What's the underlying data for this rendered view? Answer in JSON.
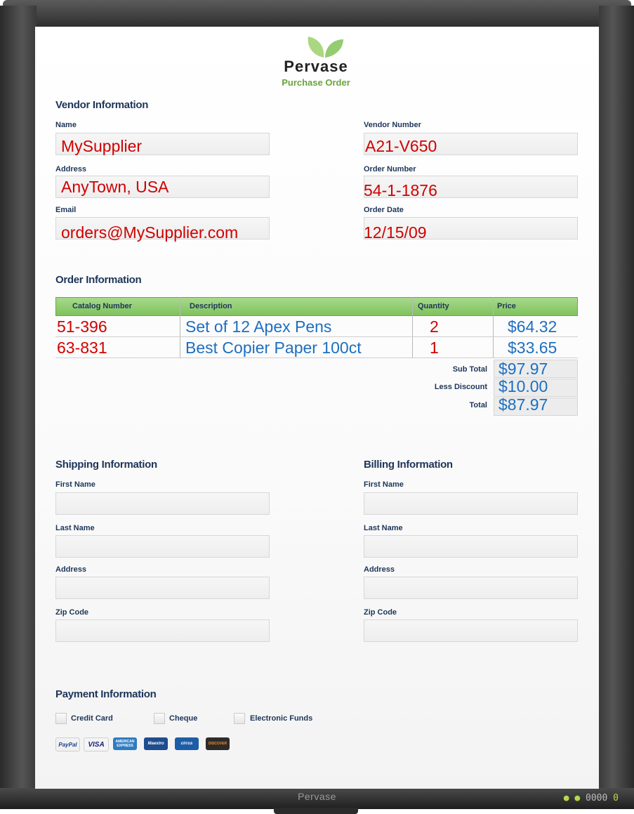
{
  "monitor": {
    "brand": "Pervase",
    "indicators": "• • 0000 0"
  },
  "header": {
    "brand": "Pervase",
    "subtitle": "Purchase Order"
  },
  "vendor": {
    "section_title": "Vendor Information",
    "name_label": "Name",
    "name_value": "MySupplier",
    "address_label": "Address",
    "address_value": "AnyTown, USA",
    "email_label": "Email",
    "email_value": "orders@MySupplier.com",
    "vendor_number_label": "Vendor Number",
    "vendor_number_value": "A21-V650",
    "order_number_label": "Order Number",
    "order_number_value": "54-1-1876",
    "order_date_label": "Order Date",
    "order_date_value": "12/15/09"
  },
  "order": {
    "section_title": "Order Information",
    "columns": [
      "Catalog Number",
      "Description",
      "Quantity",
      "Price"
    ],
    "rows": [
      {
        "catalog": "51-396",
        "description": "Set of 12 Apex Pens",
        "quantity": "2",
        "price": "$64.32"
      },
      {
        "catalog": "63-831",
        "description": "Best Copier Paper 100ct",
        "quantity": "1",
        "price": "$33.65"
      }
    ],
    "sub_total_label": "Sub Total",
    "sub_total": "$97.97",
    "discount_label": "Less Discount",
    "discount": "$10.00",
    "total_label": "Total",
    "total": "$87.97"
  },
  "shipping": {
    "section_title": "Shipping Information",
    "first_name_label": "First Name",
    "last_name_label": "Last Name",
    "address_label": "Address",
    "zip_label": "Zip Code"
  },
  "billing": {
    "section_title": "Billing Information",
    "first_name_label": "First Name",
    "last_name_label": "Last Name",
    "address_label": "Address",
    "zip_label": "Zip Code"
  },
  "payment": {
    "section_title": "Payment Information",
    "options": [
      "Credit Card",
      "Cheque",
      "Electronic Funds"
    ],
    "cards": [
      "PayPal",
      "VISA",
      "AMERICAN EXPRESS",
      "Maestro",
      "cirrus",
      "DISCOVER"
    ]
  },
  "colors": {
    "accent_green": "#7fc25d",
    "value_red": "#d10000",
    "value_blue": "#1e6fc0",
    "heading_navy": "#1d3558"
  }
}
